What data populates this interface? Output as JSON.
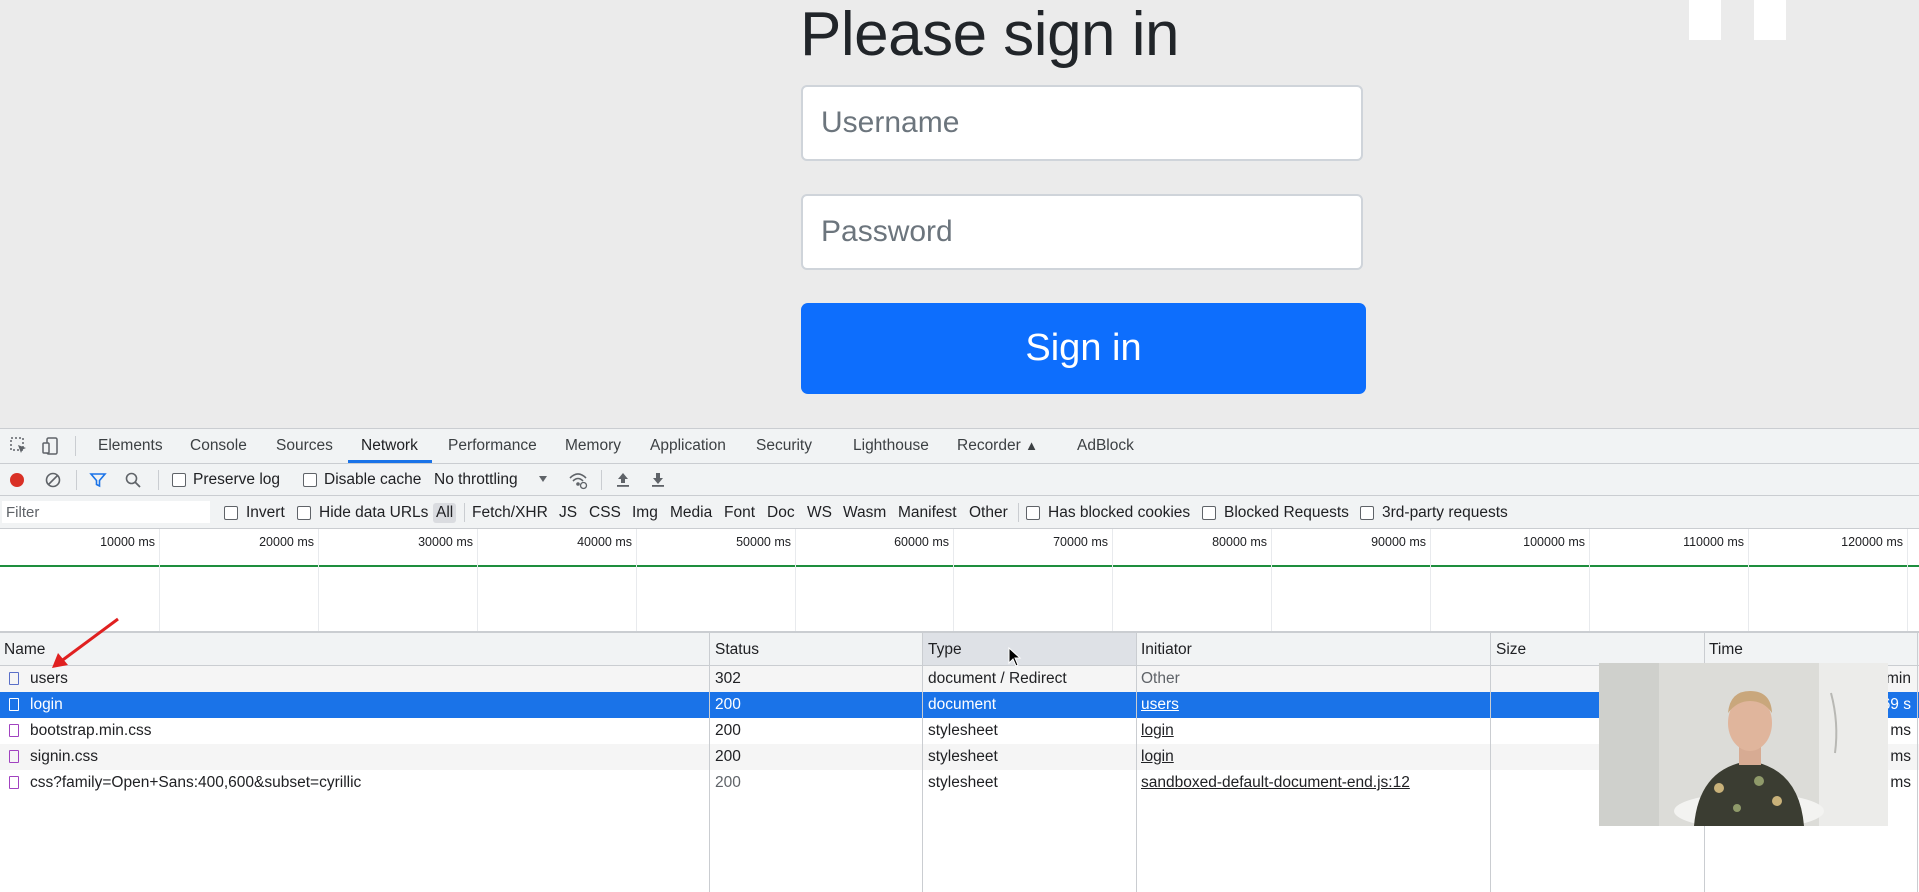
{
  "page": {
    "title": "Please sign in",
    "username_placeholder": "Username",
    "password_placeholder": "Password",
    "signin_label": "Sign in"
  },
  "devtools": {
    "tabs": [
      "Elements",
      "Console",
      "Sources",
      "Network",
      "Performance",
      "Memory",
      "Application",
      "Security",
      "Lighthouse",
      "Recorder",
      "AdBlock"
    ],
    "active_tab": "Network",
    "toolbar": {
      "preserve_log": "Preserve log",
      "disable_cache": "Disable cache",
      "throttling": "No throttling"
    },
    "filter": {
      "placeholder": "Filter",
      "invert": "Invert",
      "hide_data_urls": "Hide data URLs",
      "types": [
        "All",
        "Fetch/XHR",
        "JS",
        "CSS",
        "Img",
        "Media",
        "Font",
        "Doc",
        "WS",
        "Wasm",
        "Manifest",
        "Other"
      ],
      "has_blocked_cookies": "Has blocked cookies",
      "blocked_requests": "Blocked Requests",
      "third_party": "3rd-party requests"
    },
    "overview_ticks": [
      "10000 ms",
      "20000 ms",
      "30000 ms",
      "40000 ms",
      "50000 ms",
      "60000 ms",
      "70000 ms",
      "80000 ms",
      "90000 ms",
      "100000 ms",
      "110000 ms",
      "120000 ms"
    ],
    "columns": [
      "Name",
      "Status",
      "Type",
      "Initiator",
      "Size",
      "Time"
    ],
    "rows": [
      {
        "name": "users",
        "status": "302",
        "type": "document / Redirect",
        "initiator": "Other",
        "time": "min"
      },
      {
        "name": "login",
        "status": "200",
        "type": "document",
        "initiator": "users",
        "time": "69 s"
      },
      {
        "name": "bootstrap.min.css",
        "status": "200",
        "type": "stylesheet",
        "initiator": "login",
        "time": "ms"
      },
      {
        "name": "signin.css",
        "status": "200",
        "type": "stylesheet",
        "initiator": "login",
        "time": "ms"
      },
      {
        "name": "css?family=Open+Sans:400,600&subset=cyrillic",
        "status": "200",
        "type": "stylesheet",
        "initiator": "sandboxed-default-document-end.js:12",
        "time": "ms"
      }
    ]
  }
}
